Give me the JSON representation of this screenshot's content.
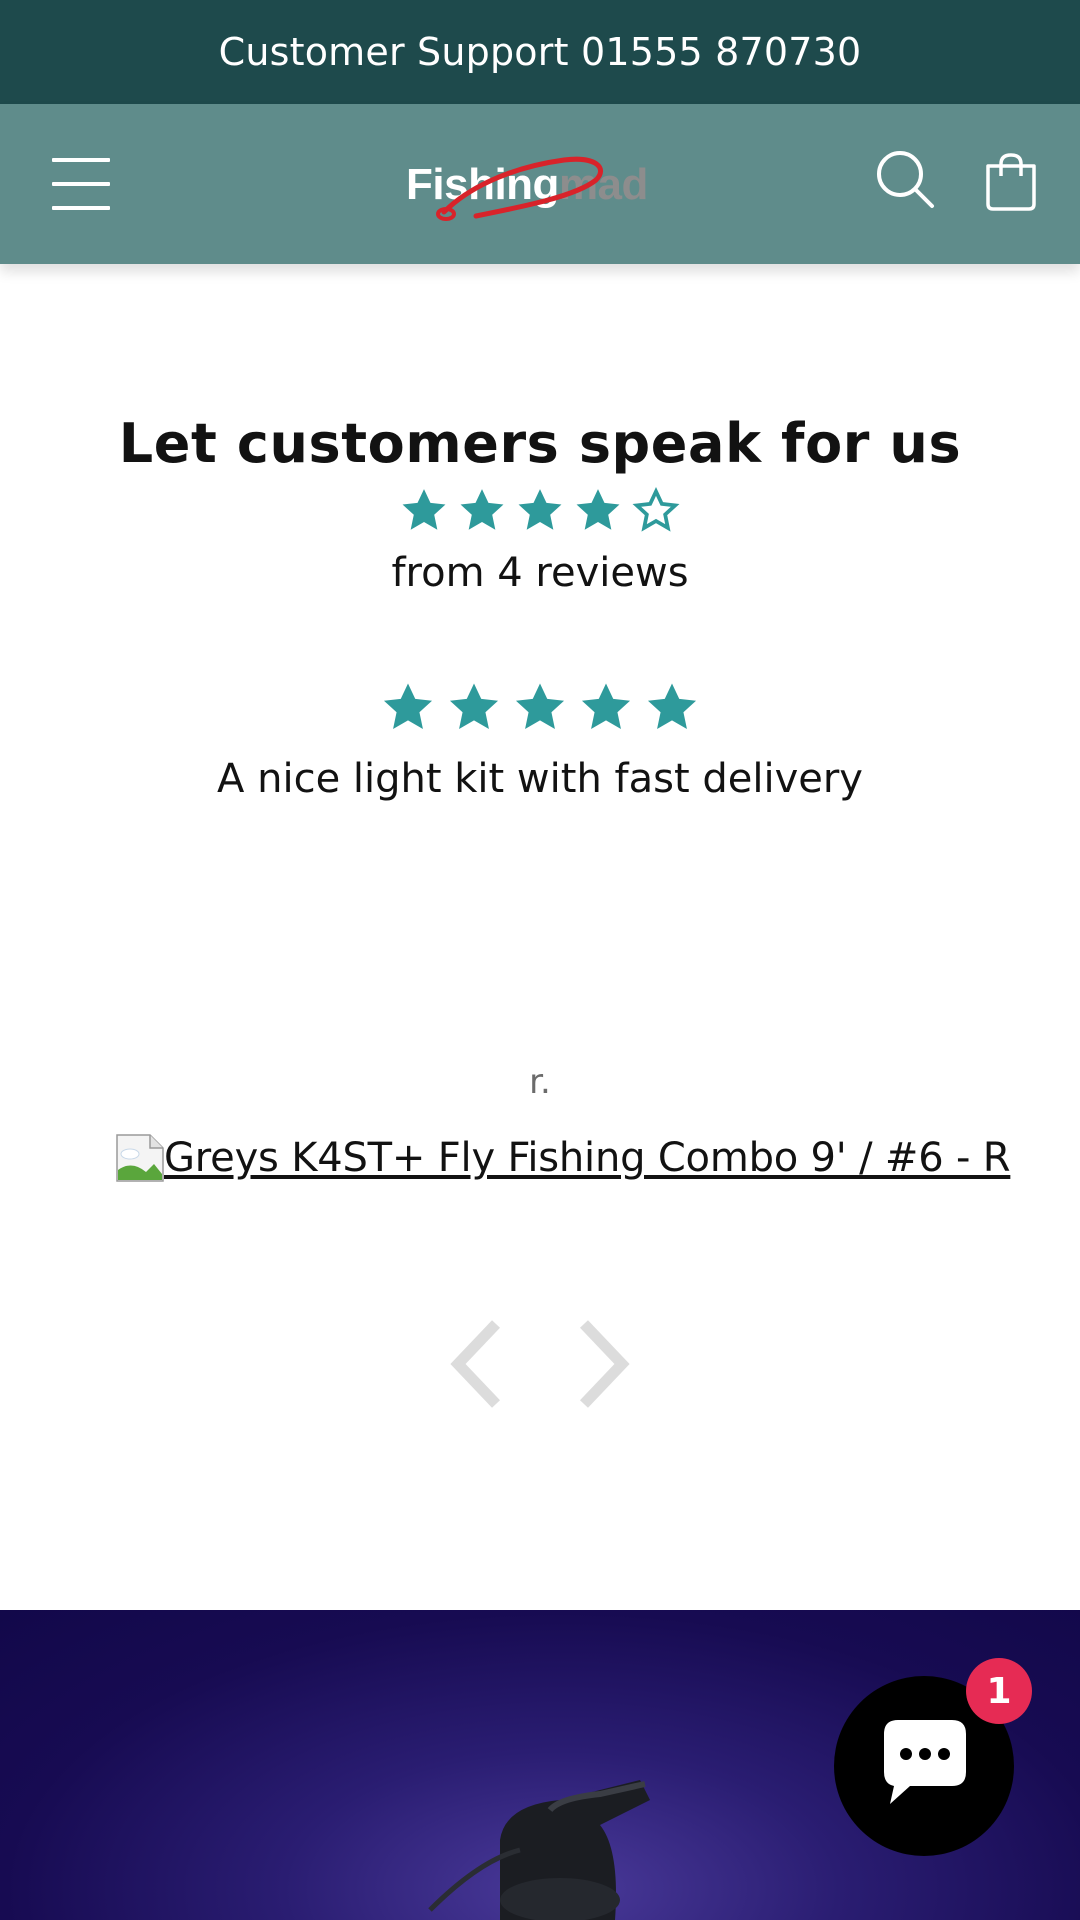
{
  "announcement": {
    "text": "Customer Support 01555 870730"
  },
  "header": {
    "logo": {
      "text_primary": "Fishing",
      "text_secondary": "mad"
    },
    "icons": {
      "menu": "hamburger-icon",
      "search": "search-icon",
      "cart": "shopping-bag-icon"
    }
  },
  "reviews": {
    "title": "Let customers speak for us",
    "summary": {
      "rating": 4,
      "max": 5,
      "count_label": "from 4 reviews"
    },
    "current_review": {
      "rating": 5,
      "max": 5,
      "text": "A nice light kit with fast delivery",
      "reviewer": "r.",
      "product_link": "Greys K4ST+ Fly Fishing Combo 9' / #6 - R"
    },
    "nav": {
      "prev": "chevron-left-icon",
      "next": "chevron-right-icon"
    }
  },
  "chat": {
    "badge_count": "1",
    "icon": "chat-bubble-icon"
  },
  "colors": {
    "announcement_bg": "#1e4a4c",
    "header_bg": "#5f8c8b",
    "star": "#2e9a9b",
    "banner_bg": "#170b52",
    "badge": "#e62b54"
  }
}
